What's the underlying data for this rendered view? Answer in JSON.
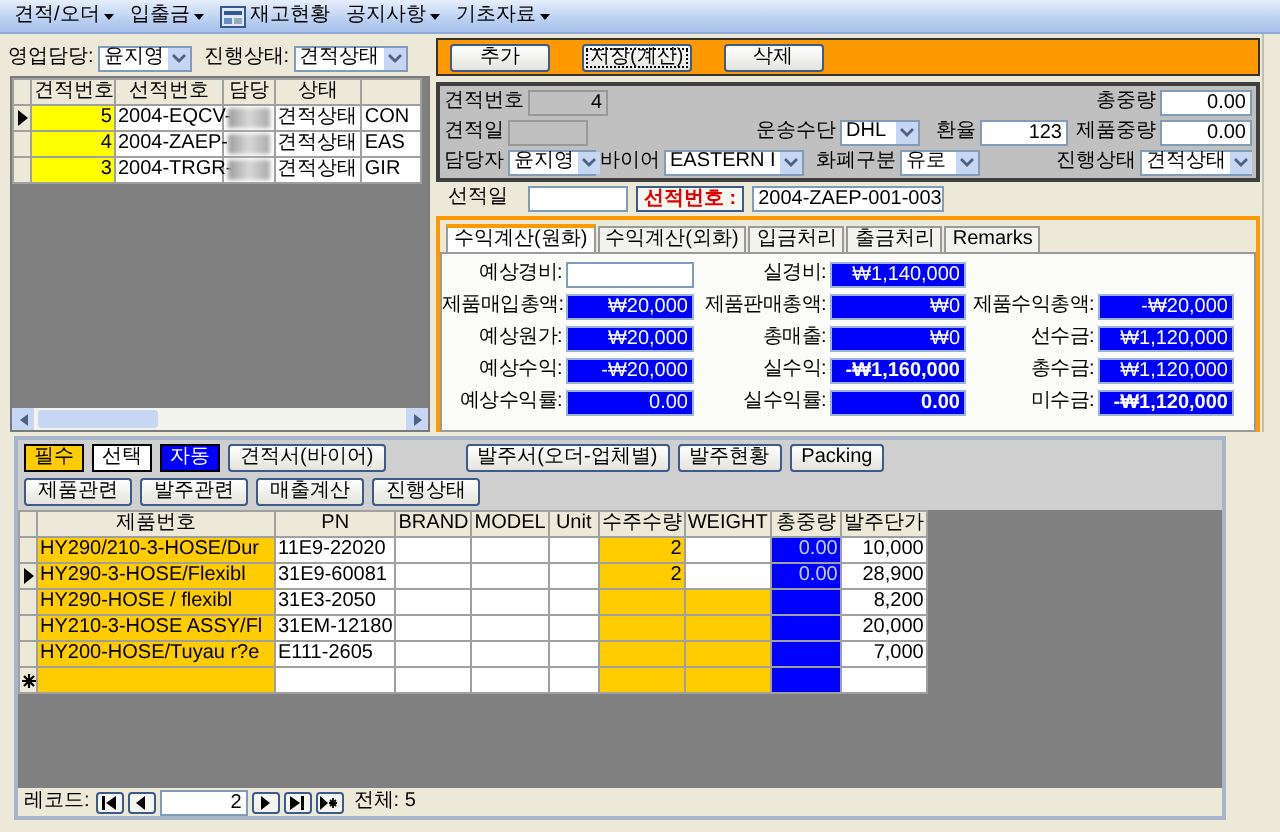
{
  "menu": [
    {
      "label": "견적/오더",
      "dropdown": true,
      "icon": false
    },
    {
      "label": "입출금",
      "dropdown": true,
      "icon": false
    },
    {
      "label": "재고현황",
      "dropdown": false,
      "icon": true
    },
    {
      "label": "공지사항",
      "dropdown": true,
      "icon": false
    },
    {
      "label": "기초자료",
      "dropdown": true,
      "icon": false
    }
  ],
  "filters": [
    {
      "label": "영업담당:",
      "value": "윤지영"
    },
    {
      "label": "진행상태:",
      "value": "견적상태"
    }
  ],
  "estimate_list": {
    "columns": [
      {
        "label": "견적번호",
        "kind": "required"
      },
      {
        "label": "선적번호",
        "kind": "optional"
      },
      {
        "label": "담당",
        "kind": "optional"
      },
      {
        "label": "상태",
        "kind": "optional"
      },
      {
        "kind": "optional"
      }
    ],
    "rows": [
      {
        "current": true,
        "cells": [
          "5",
          "2004-EQCV-",
          null,
          "견적상태",
          "CON"
        ]
      },
      {
        "current": false,
        "cells": [
          "4",
          "2004-ZAEP-",
          null,
          "견적상태",
          "EAS"
        ]
      },
      {
        "current": false,
        "cells": [
          "3",
          "2004-TRGR-",
          null,
          "견적상태",
          "GIR"
        ]
      }
    ]
  },
  "toolbar": {
    "buttons": [
      {
        "label": "추가",
        "focused": false
      },
      {
        "label": "저장(계산)",
        "focused": true
      },
      {
        "label": "삭제",
        "focused": false
      }
    ]
  },
  "header_form": {
    "estimate_no": {
      "label": "견적번호",
      "value": "4",
      "kind": "readonly"
    },
    "total_weight": {
      "label": "총중량",
      "value": "0.00",
      "kind": "text"
    },
    "estimate_date": {
      "label": "견적일",
      "kind": "readonly"
    },
    "transport": {
      "label": "운송수단",
      "value": "DHL",
      "kind": "dropdown"
    },
    "exchange_rate": {
      "label": "환율",
      "value": "123",
      "kind": "text"
    },
    "product_weight": {
      "label": "제품중량",
      "value": "0.00",
      "kind": "text"
    },
    "manager": {
      "label": "담당자",
      "value": "윤지영",
      "kind": "dropdown"
    },
    "buyer": {
      "label": "바이어",
      "value": "EASTERN I",
      "kind": "dropdown"
    },
    "currency": {
      "label": "화폐구분",
      "value": "유로",
      "kind": "dropdown"
    },
    "progress_status": {
      "label": "진행상태",
      "value": "견적상태",
      "kind": "dropdown"
    }
  },
  "shipping": {
    "date_label": "선적일",
    "number_label": "선적번호 :",
    "number": "2004-ZAEP-001-003"
  },
  "tabs": [
    {
      "label": "수익계산(원화)",
      "selected": true
    },
    {
      "label": "수익계산(외화)",
      "selected": false
    },
    {
      "label": "입금처리",
      "selected": false
    },
    {
      "label": "출금처리",
      "selected": false
    },
    {
      "label": "Remarks",
      "selected": false
    }
  ],
  "profit_columns": [
    [
      {
        "label": "예상경비:",
        "kind": "input"
      },
      {
        "label": "제품매입총액:",
        "kind": "computed",
        "value": "₩20,000",
        "strong": false
      },
      {
        "label": "예상원가:",
        "kind": "computed",
        "value": "₩20,000",
        "strong": false
      },
      {
        "label": "예상수익:",
        "kind": "computed",
        "value": "-₩20,000",
        "strong": false
      },
      {
        "label": "예상수익률:",
        "kind": "computed",
        "value": "0.00",
        "strong": false
      }
    ],
    [
      {
        "label": "실경비:",
        "kind": "computed",
        "value": "₩1,140,000",
        "strong": false
      },
      {
        "label": "제품판매총액:",
        "kind": "computed",
        "value": "₩0",
        "strong": false
      },
      {
        "label": "총매출:",
        "kind": "computed",
        "value": "₩0",
        "strong": false
      },
      {
        "label": "실수익:",
        "kind": "computed",
        "value": "-₩1,160,000",
        "strong": true
      },
      {
        "label": "실수익률:",
        "kind": "computed",
        "value": "0.00",
        "strong": true
      }
    ],
    [
      {
        "label": "제품수익총액:",
        "kind": "computed",
        "value": "-₩20,000",
        "strong": false
      },
      {
        "label": "선수금:",
        "kind": "computed",
        "value": "₩1,120,000",
        "strong": false
      },
      {
        "label": "총수금:",
        "kind": "computed",
        "value": "₩1,120,000",
        "strong": false
      },
      {
        "label": "미수금:",
        "kind": "computed",
        "value": "-₩1,120,000",
        "strong": true
      }
    ]
  ],
  "legend": [
    {
      "label": "필수",
      "kind": "required"
    },
    {
      "label": "선택",
      "kind": "optional"
    },
    {
      "label": "자동",
      "kind": "auto"
    }
  ],
  "report_buttons": [
    "견적서(바이어)"
  ],
  "order_buttons": [
    "발주서(오더-업체별)",
    "발주현황",
    "Packing"
  ],
  "section_buttons": [
    "제품관련",
    "발주관련",
    "매출계산",
    "진행상태"
  ],
  "product_grid": {
    "columns": [
      {
        "label": "제품번호",
        "kind": "required"
      },
      {
        "label": "PN",
        "kind": "optional"
      },
      {
        "label": "BRAND",
        "kind": "optional"
      },
      {
        "label": "MODEL",
        "kind": "optional"
      },
      {
        "label": "Unit",
        "kind": "optional"
      },
      {
        "label": "수주수량",
        "kind": "required"
      },
      {
        "label": "WEIGHT",
        "kind": "weight"
      },
      {
        "label": "총중량",
        "kind": "auto"
      },
      {
        "label": "발주단가",
        "kind": "optional"
      }
    ],
    "rows": [
      {
        "current": false,
        "weight_required": false,
        "cells": [
          "HY290/210-3-HOSE/Dur",
          "11E9-22020",
          null,
          null,
          null,
          "2",
          null,
          "0.00",
          "10,000"
        ]
      },
      {
        "current": true,
        "weight_required": false,
        "cells": [
          "HY290-3-HOSE/Flexibl",
          "31E9-60081",
          null,
          null,
          null,
          "2",
          null,
          "0.00",
          "28,900"
        ]
      },
      {
        "current": false,
        "weight_required": true,
        "cells": [
          "HY290-HOSE / flexibl",
          "31E3-2050",
          null,
          null,
          null,
          null,
          null,
          null,
          "8,200"
        ]
      },
      {
        "current": false,
        "weight_required": true,
        "cells": [
          "HY210-3-HOSE ASSY/Fl",
          "31EM-12180",
          null,
          null,
          null,
          null,
          null,
          null,
          "20,000"
        ]
      },
      {
        "current": false,
        "weight_required": true,
        "cells": [
          "HY200-HOSE/Tuyau r?e",
          "E111-2605",
          null,
          null,
          null,
          null,
          null,
          null,
          "7,000"
        ]
      }
    ],
    "new_row": true
  },
  "record_nav": {
    "label": "레코드:",
    "current": "2",
    "total": "전체: 5"
  }
}
